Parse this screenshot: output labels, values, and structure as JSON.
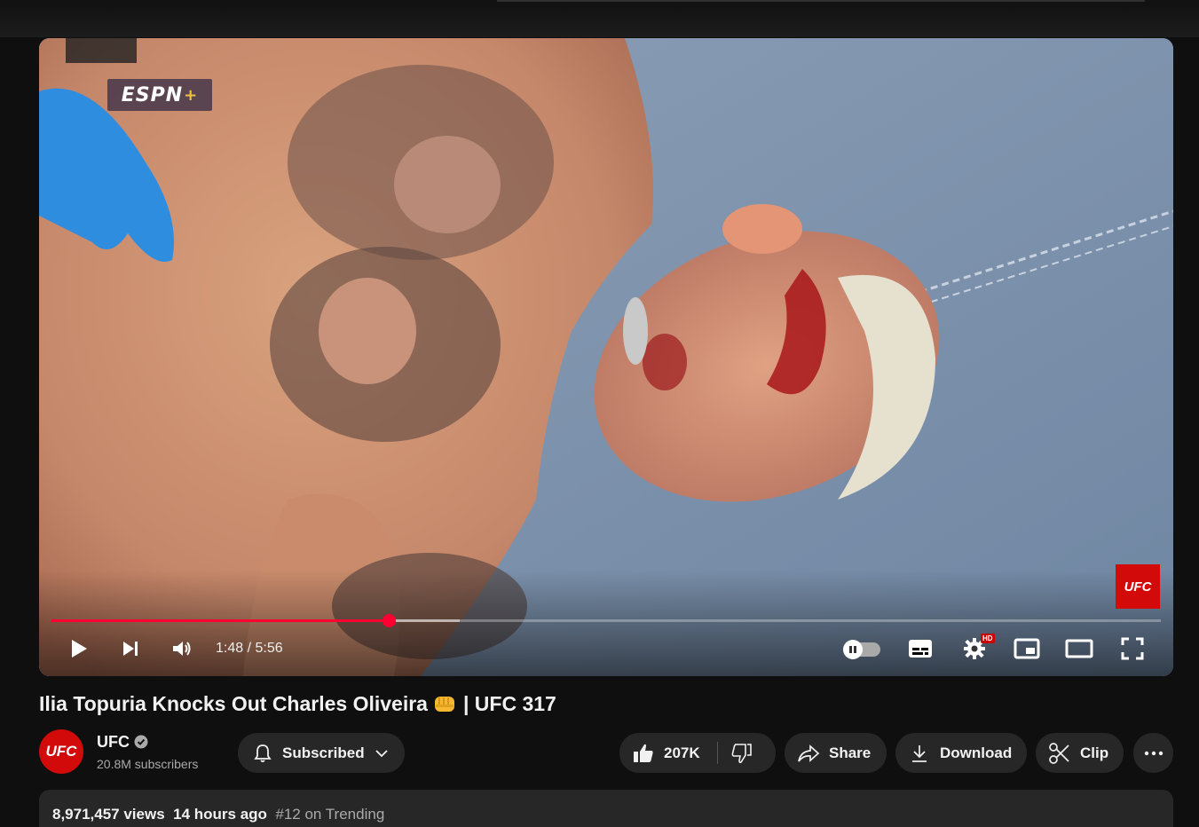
{
  "player": {
    "espn_logo": "ESPN+",
    "espn_logo_main": "ESPN",
    "espn_logo_plus": "+",
    "ufc_watermark": "UFC",
    "time_display": "1:48 / 5:56",
    "progress_fraction": 0.304,
    "buffer_fraction": 0.368,
    "hd_badge": "HD",
    "icons": [
      "play-icon",
      "next-icon",
      "volume-icon",
      "autoplay-toggle",
      "subtitles-icon",
      "settings-icon",
      "miniplayer-icon",
      "theater-icon",
      "fullscreen-icon"
    ]
  },
  "video": {
    "title_part1": "Ilia Topuria Knocks Out Charles Oliveira",
    "title_emoji": "👊",
    "title_part2": "| UFC 317"
  },
  "channel": {
    "avatar_text": "UFC",
    "name": "UFC",
    "subscribers": "20.8M subscribers",
    "subscribe_label": "Subscribed"
  },
  "actions": {
    "like_count": "207K",
    "share_label": "Share",
    "download_label": "Download",
    "clip_label": "Clip"
  },
  "description": {
    "views": "8,971,457 views",
    "time_ago": "14 hours ago",
    "trending": "#12 on Trending"
  },
  "colors": {
    "accent_red": "#ff0033",
    "ufc_red": "#d20a0a",
    "pill_bg": "#272727",
    "page_bg": "#0f0f0f"
  }
}
